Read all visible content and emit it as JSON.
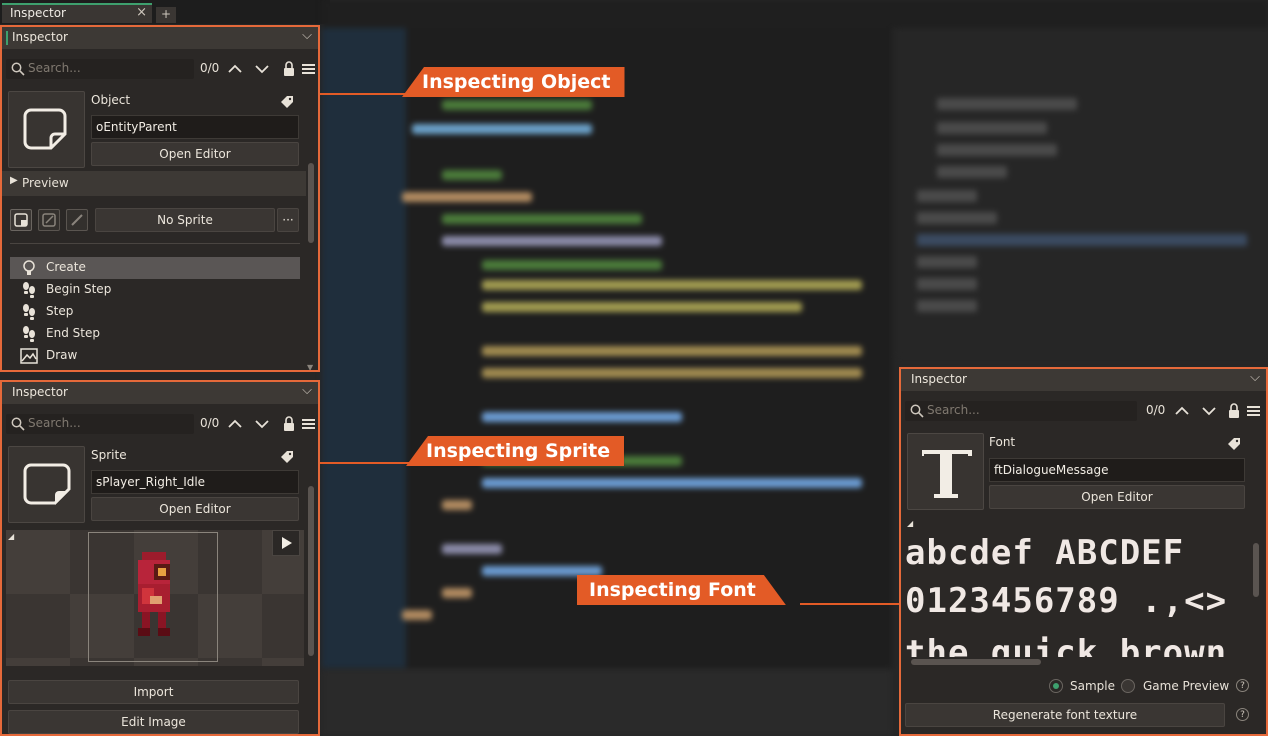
{
  "tab": {
    "title": "Inspector",
    "close": "×",
    "add": "+"
  },
  "callouts": {
    "object": "Inspecting Object",
    "sprite": "Inspecting Sprite",
    "font": "Inspecting Font"
  },
  "object_panel": {
    "header": "Inspector",
    "search_placeholder": "Search...",
    "counter": "0/0",
    "type_label": "Object",
    "name": "oEntityParent",
    "open_editor": "Open Editor",
    "preview_label": "Preview",
    "sprite_button": "No Sprite",
    "more_button": "···",
    "events": [
      {
        "label": "Create",
        "icon": "lightbulb-icon",
        "selected": true
      },
      {
        "label": "Begin Step",
        "icon": "footsteps-icon"
      },
      {
        "label": "Step",
        "icon": "footsteps-icon"
      },
      {
        "label": "End Step",
        "icon": "footsteps-icon"
      },
      {
        "label": "Draw",
        "icon": "image-icon"
      }
    ]
  },
  "sprite_panel": {
    "header": "Inspector",
    "search_placeholder": "Search...",
    "counter": "0/0",
    "type_label": "Sprite",
    "name": "sPlayer_Right_Idle",
    "open_editor": "Open Editor",
    "import_button": "Import",
    "edit_image_button": "Edit Image"
  },
  "font_panel": {
    "header": "Inspector",
    "search_placeholder": "Search...",
    "counter": "0/0",
    "type_label": "Font",
    "name": "ftDialogueMessage",
    "open_editor": "Open Editor",
    "sample_line_1": "abcdef ABCDEF",
    "sample_line_2": "0123456789 .,<>",
    "sample_line_3": "the quick brown fox",
    "radio_sample": "Sample",
    "radio_game_preview": "Game Preview",
    "regenerate_button": "Regenerate font texture",
    "help": "?"
  },
  "colors": {
    "accent_orange": "#e35b26",
    "panel_bg": "#2b2826",
    "active_green": "#3ea06e"
  }
}
